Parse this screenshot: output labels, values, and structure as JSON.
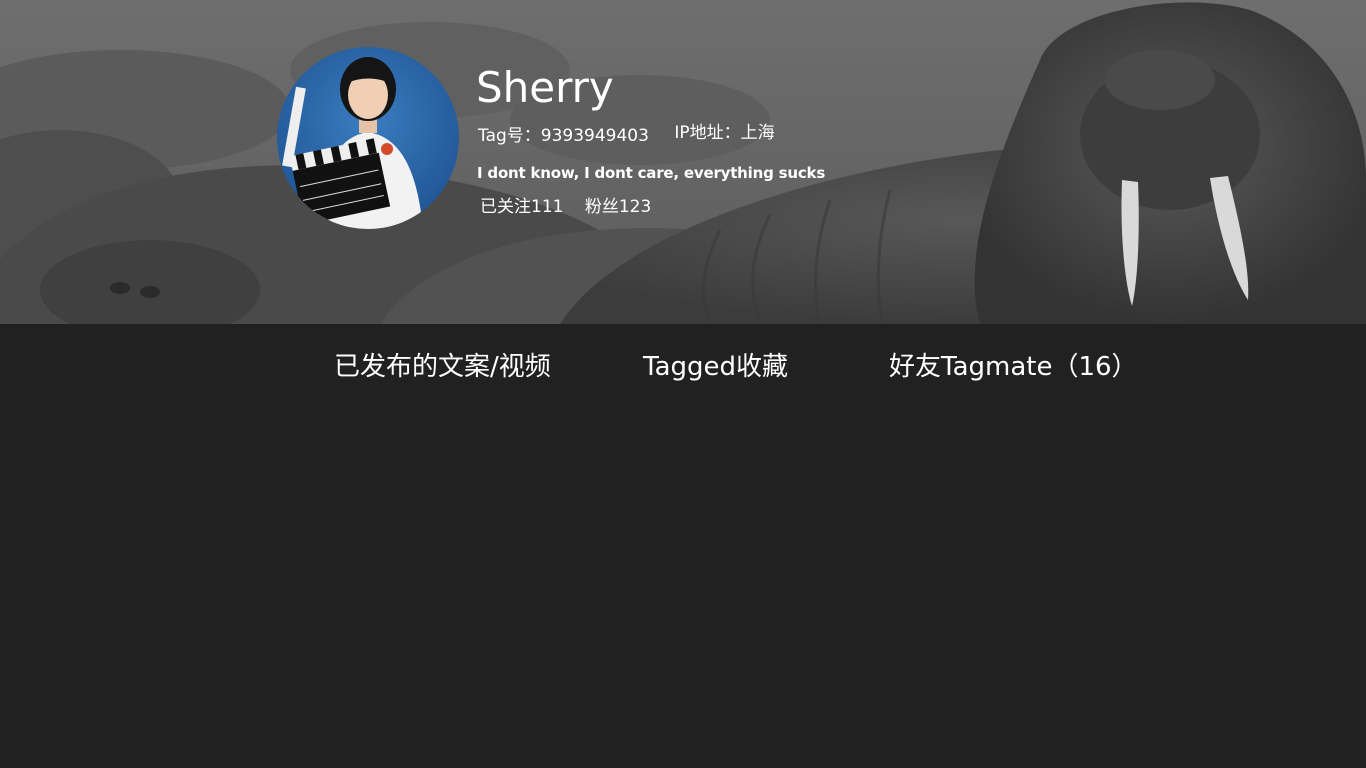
{
  "profile": {
    "username": "Sherry",
    "tag_label": "Tag号：",
    "tag_value": "9393949403",
    "ip_label": "IP地址：",
    "ip_value": "上海",
    "bio": "I dont know, I dont care, everything sucks",
    "following": "已关注111",
    "followers": "粉丝123"
  },
  "tabs": [
    {
      "label": "已发布的文案/视频"
    },
    {
      "label": "Tagged收藏"
    },
    {
      "label": "好友Tagmate（16）"
    }
  ],
  "colors": {
    "page_background": "#212121",
    "text": "#ffffff"
  }
}
